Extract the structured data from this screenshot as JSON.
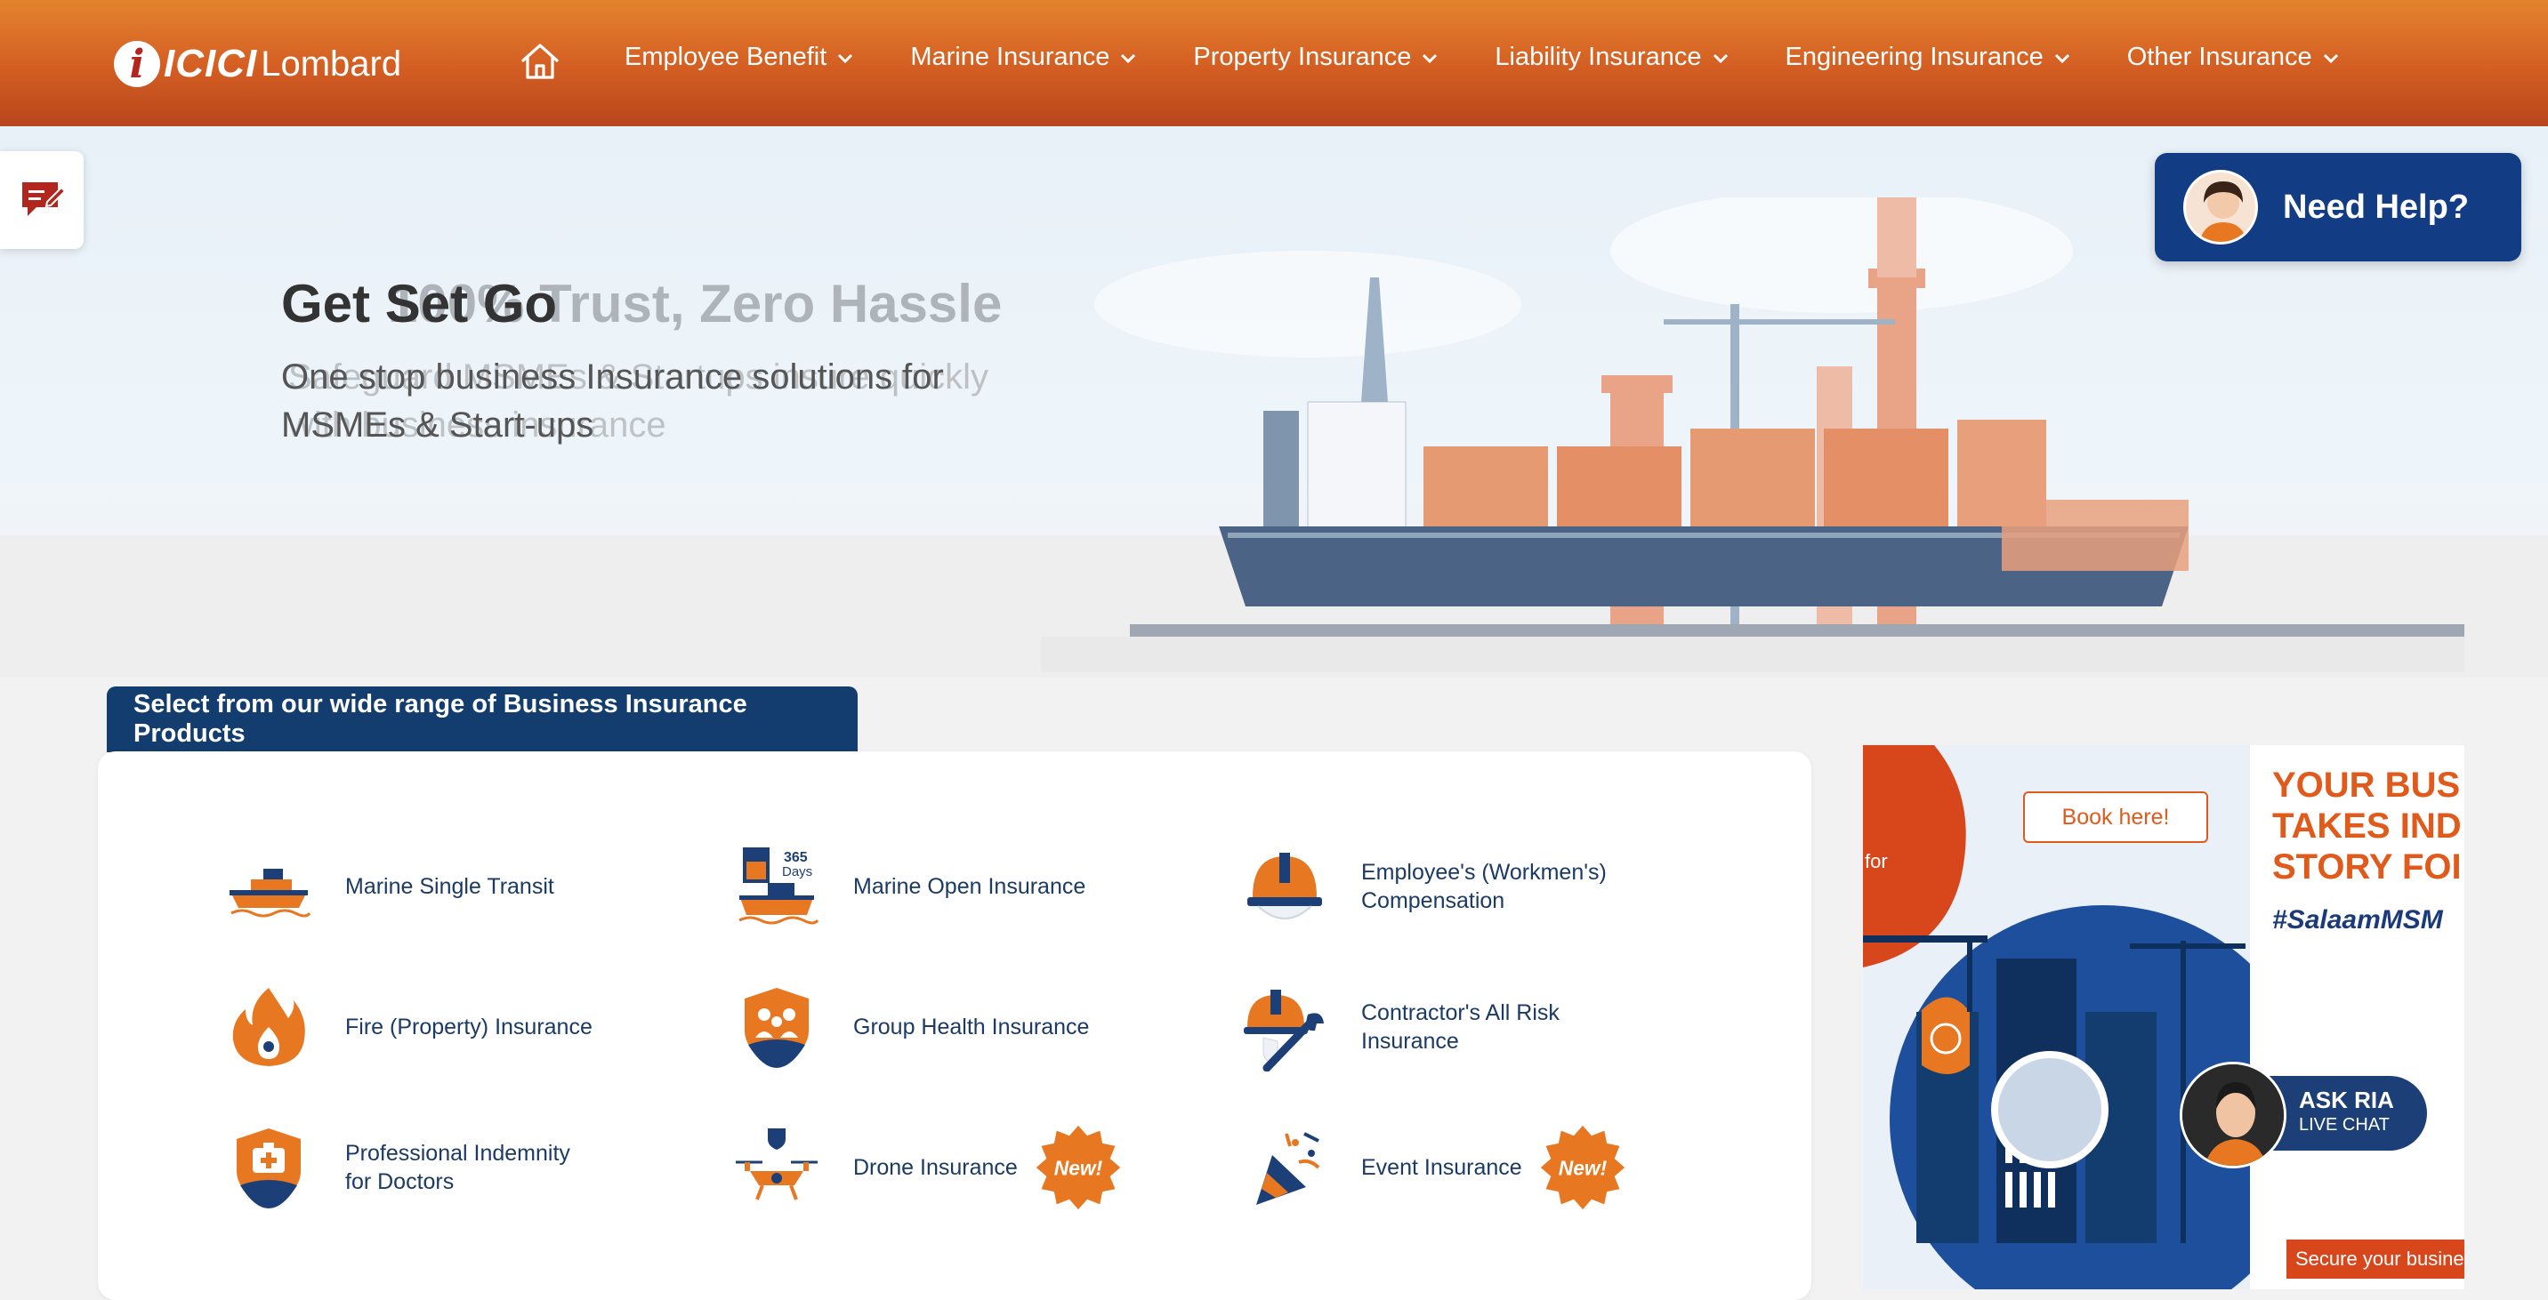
{
  "brand": {
    "logo_mark": "i",
    "logo_word1": "ICICI",
    "logo_word2": "Lombard"
  },
  "nav": {
    "home_icon": "home-icon",
    "items": [
      {
        "label": "Employee Benefit"
      },
      {
        "label": "Marine Insurance"
      },
      {
        "label": "Property Insurance"
      },
      {
        "label": "Liability Insurance"
      },
      {
        "label": "Engineering Insurance"
      },
      {
        "label": "Other Insurance"
      }
    ]
  },
  "hero": {
    "title": "Get Set Go",
    "title_ghost": "100% Trust, Zero Hassle",
    "subtitle": "One stop business Insurance solutions for MSMEs & Start-ups",
    "subtitle_ghost": "Safeguard MSMEs & Startups insure quickly with business insurance",
    "slides_total": 3,
    "active_slide": 2
  },
  "help": {
    "label": "Need Help?"
  },
  "products": {
    "heading": "Select from our wide range of Business Insurance Products",
    "items": [
      {
        "label": "Marine Single Transit",
        "icon": "ship-icon"
      },
      {
        "label": "Marine Open Insurance",
        "icon": "calendar-ship-icon",
        "icon_text": "365 Days"
      },
      {
        "label": "Employee's (Workmen's) Compensation",
        "icon": "helmet-icon"
      },
      {
        "label": "Fire (Property) Insurance",
        "icon": "fire-icon"
      },
      {
        "label": "Group Health Insurance",
        "icon": "family-shield-icon"
      },
      {
        "label": "Contractor's All Risk Insurance",
        "icon": "helmet-wrench-icon"
      },
      {
        "label": "Professional Indemnity for Doctors",
        "icon": "medical-kit-icon"
      },
      {
        "label": "Drone Insurance",
        "icon": "drone-icon",
        "badge": "New!"
      },
      {
        "label": "Event Insurance",
        "icon": "party-popper-icon",
        "badge": "New!"
      }
    ]
  },
  "promo": {
    "headline": "YOUR BUSINESS TAKES INDIA'S STORY FORWARD",
    "headline_lines": [
      "YOUR BUS",
      "TAKES IND",
      "STORY FOI"
    ],
    "hashtag": "#SalaamMSM",
    "book_label": "Book here!",
    "for_text": "for",
    "secure_text": "Secure your busine"
  },
  "chat": {
    "title": "ASK RIA",
    "subtitle": "LIVE CHAT"
  },
  "colors": {
    "nav_orange": "#d35d22",
    "navy": "#123d6e",
    "accent": "#e87722"
  }
}
